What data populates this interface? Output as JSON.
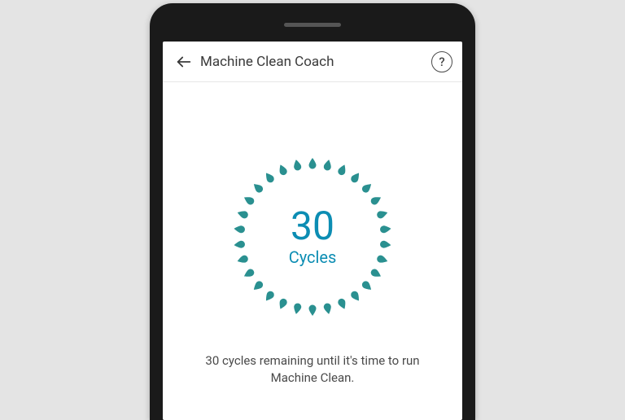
{
  "header": {
    "title": "Machine Clean Coach"
  },
  "gauge": {
    "value": "30",
    "unit": "Cycles",
    "tick_count": 30,
    "tick_color": "#2a9090",
    "accent_color": "#0c8db3"
  },
  "message": "30 cycles remaining until it's time to run Machine Clean."
}
